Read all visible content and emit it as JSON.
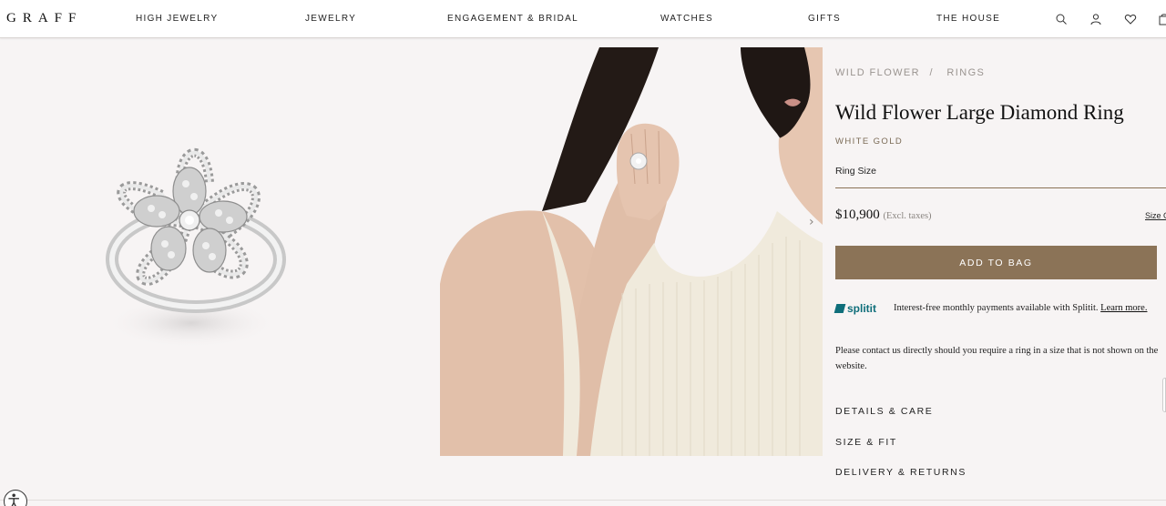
{
  "brand": {
    "logo": "GRAFF"
  },
  "nav": {
    "items": [
      {
        "label": "HIGH JEWELRY"
      },
      {
        "label": "JEWELRY"
      },
      {
        "label": "ENGAGEMENT & BRIDAL"
      },
      {
        "label": "WATCHES"
      },
      {
        "label": "GIFTS"
      },
      {
        "label": "THE HOUSE"
      }
    ],
    "icons": [
      "search-icon",
      "account-icon",
      "wishlist-heart-icon",
      "bag-icon"
    ]
  },
  "breadcrumb": {
    "collection": "WILD FLOWER",
    "separator": "/",
    "category": "RINGS"
  },
  "product": {
    "title": "Wild Flower Large Diamond Ring",
    "material": "WHITE GOLD",
    "ring_size_label": "Ring Size",
    "price": "$10,900",
    "price_note": "(Excl. taxes)",
    "size_guide_label": "Size G",
    "add_to_bag": "ADD TO BAG"
  },
  "splitit": {
    "logo": "splitit",
    "text": "Interest-free monthly payments available with Splitit.",
    "link": "Learn more."
  },
  "contact_text": "Please contact us directly should you require a ring in a size that is not shown on the website.",
  "accordions": [
    "DETAILS & CARE",
    "SIZE & FIT",
    "DELIVERY & RETURNS"
  ],
  "colors": {
    "accent": "#8b7357",
    "background": "#f7f4f4",
    "splitit": "#0f6e7a"
  }
}
